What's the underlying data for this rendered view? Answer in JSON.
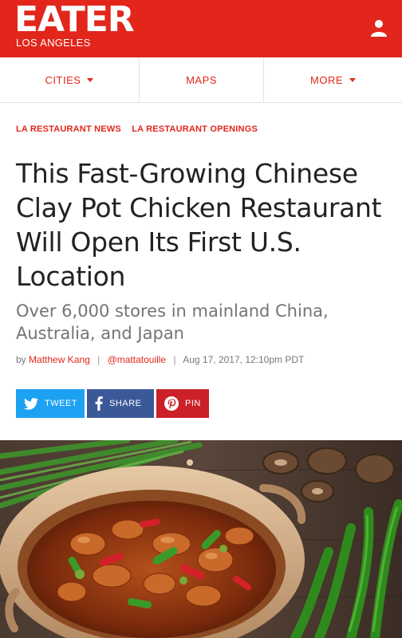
{
  "header": {
    "logo": "EATER",
    "city": "LOS ANGELES",
    "user_icon": "user-icon"
  },
  "nav": {
    "items": [
      {
        "label": "CITIES"
      },
      {
        "label": "MAPS"
      },
      {
        "label": "MORE"
      }
    ]
  },
  "article": {
    "tags": [
      "LA RESTAURANT NEWS",
      "LA RESTAURANT OPENINGS"
    ],
    "title": "This Fast-Growing Chinese Clay Pot Chicken Restaurant Will Open Its First U.S. Location",
    "dek": "Over 6,000 stores in mainland China, Australia, and Japan",
    "byline": {
      "by": "by",
      "author": "Matthew Kang",
      "handle": "@mattatouille",
      "timestamp": "Aug 17, 2017, 12:10pm PDT"
    }
  },
  "share": {
    "tweet": "TWEET",
    "share": "SHARE",
    "pin": "PIN"
  },
  "colors": {
    "brand": "#e2261c",
    "twitter": "#1da1f2",
    "facebook": "#3b5998",
    "pinterest": "#cb2027"
  }
}
